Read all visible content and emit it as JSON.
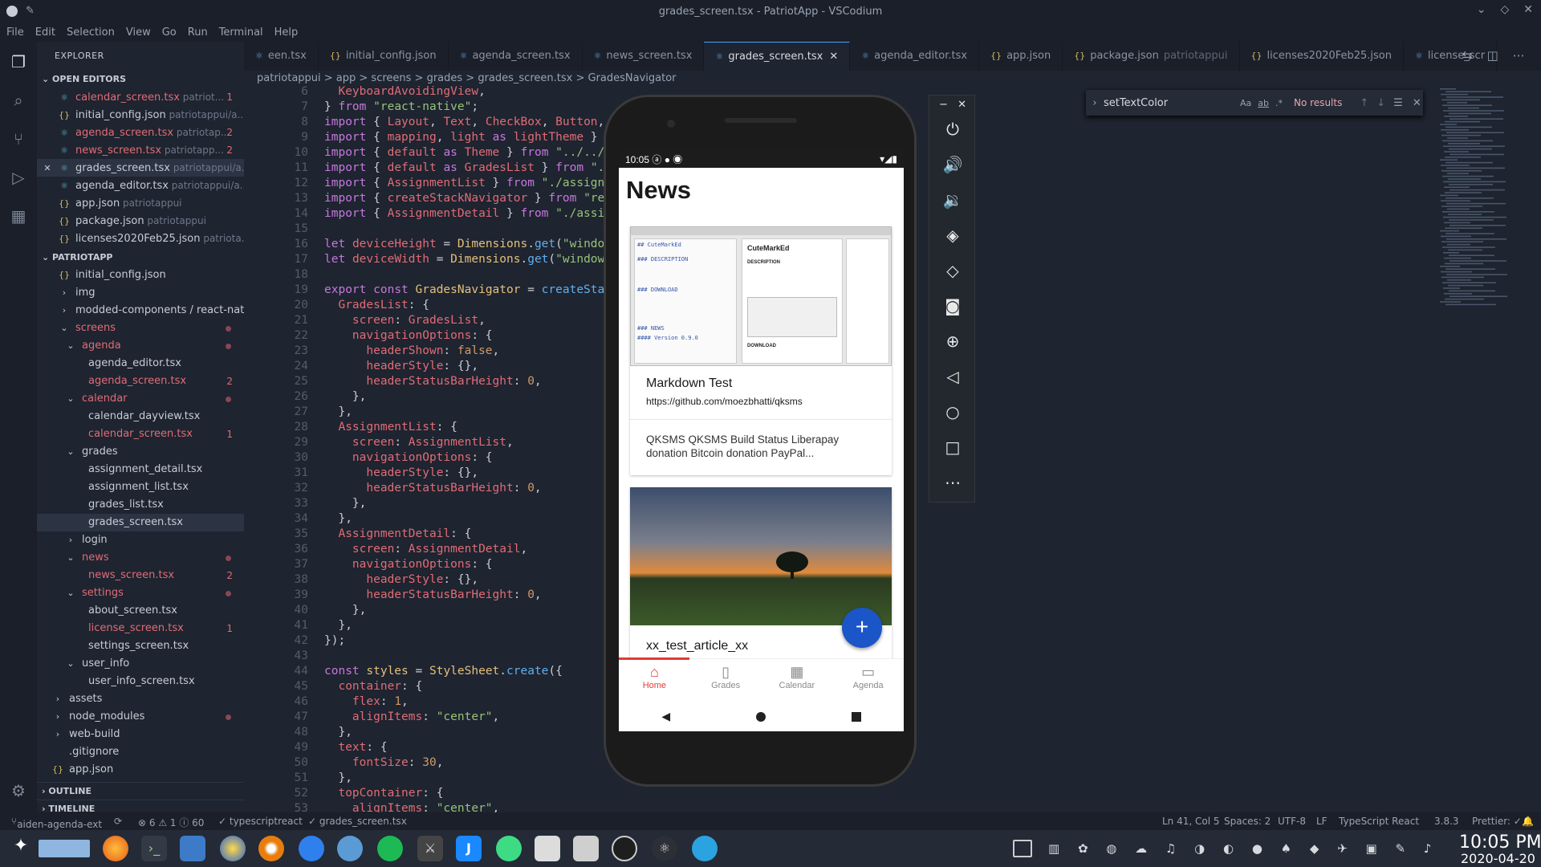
{
  "window": {
    "title": "grades_screen.tsx - PatriotApp - VSCodium"
  },
  "menu": [
    "File",
    "Edit",
    "Selection",
    "View",
    "Go",
    "Run",
    "Terminal",
    "Help"
  ],
  "explorer": {
    "title": "EXPLORER",
    "open_editors_label": "OPEN EDITORS",
    "open_editors": [
      {
        "name": "calendar_screen.tsx",
        "path": "patriot...",
        "badge": "1",
        "type": "tsx",
        "modified": true
      },
      {
        "name": "initial_config.json",
        "path": "patriotappui/a...",
        "badge": "",
        "type": "json"
      },
      {
        "name": "agenda_screen.tsx",
        "path": "patriotap...",
        "badge": "2",
        "type": "tsx",
        "modified": true
      },
      {
        "name": "news_screen.tsx",
        "path": "patriotapp...",
        "badge": "2",
        "type": "tsx",
        "modified": true
      },
      {
        "name": "grades_screen.tsx",
        "path": "patriotappui/a...",
        "badge": "",
        "type": "tsx",
        "active": true
      },
      {
        "name": "agenda_editor.tsx",
        "path": "patriotappui/a...",
        "badge": "",
        "type": "tsx"
      },
      {
        "name": "app.json",
        "path": "patriotappui",
        "badge": "",
        "type": "json"
      },
      {
        "name": "package.json",
        "path": "patriotappui",
        "badge": "",
        "type": "json"
      },
      {
        "name": "licenses2020Feb25.json",
        "path": "patriota...",
        "badge": "",
        "type": "json"
      }
    ],
    "project_label": "PATRIOTAPP",
    "tree": [
      {
        "name": "initial_config.json",
        "indent": 1,
        "kind": "json"
      },
      {
        "name": "img",
        "indent": 1,
        "kind": "folder-closed"
      },
      {
        "name": "modded-components / react-nati...",
        "indent": 1,
        "kind": "folder-closed"
      },
      {
        "name": "screens",
        "indent": 1,
        "kind": "folder-open",
        "red": true,
        "dot": true
      },
      {
        "name": "agenda",
        "indent": 2,
        "kind": "folder-open",
        "red": true,
        "dot": true
      },
      {
        "name": "agenda_editor.tsx",
        "indent": 3,
        "kind": "file"
      },
      {
        "name": "agenda_screen.tsx",
        "indent": 3,
        "kind": "file",
        "red": true,
        "badge": "2"
      },
      {
        "name": "calendar",
        "indent": 2,
        "kind": "folder-open",
        "red": true,
        "dot": true
      },
      {
        "name": "calendar_dayview.tsx",
        "indent": 3,
        "kind": "file"
      },
      {
        "name": "calendar_screen.tsx",
        "indent": 3,
        "kind": "file",
        "red": true,
        "badge": "1"
      },
      {
        "name": "grades",
        "indent": 2,
        "kind": "folder-open"
      },
      {
        "name": "assignment_detail.tsx",
        "indent": 3,
        "kind": "file"
      },
      {
        "name": "assignment_list.tsx",
        "indent": 3,
        "kind": "file"
      },
      {
        "name": "grades_list.tsx",
        "indent": 3,
        "kind": "file"
      },
      {
        "name": "grades_screen.tsx",
        "indent": 3,
        "kind": "file",
        "selected": true
      },
      {
        "name": "login",
        "indent": 2,
        "kind": "folder-closed"
      },
      {
        "name": "news",
        "indent": 2,
        "kind": "folder-open",
        "red": true,
        "dot": true
      },
      {
        "name": "news_screen.tsx",
        "indent": 3,
        "kind": "file",
        "red": true,
        "badge": "2"
      },
      {
        "name": "settings",
        "indent": 2,
        "kind": "folder-open",
        "red": true,
        "dot": true
      },
      {
        "name": "about_screen.tsx",
        "indent": 3,
        "kind": "file"
      },
      {
        "name": "license_screen.tsx",
        "indent": 3,
        "kind": "file",
        "red": true,
        "badge": "1"
      },
      {
        "name": "settings_screen.tsx",
        "indent": 3,
        "kind": "file"
      },
      {
        "name": "user_info",
        "indent": 2,
        "kind": "folder-open"
      },
      {
        "name": "user_info_screen.tsx",
        "indent": 3,
        "kind": "file"
      },
      {
        "name": "assets",
        "indent": 0,
        "kind": "folder-closed"
      },
      {
        "name": "node_modules",
        "indent": 0,
        "kind": "folder-closed",
        "dot": true
      },
      {
        "name": "web-build",
        "indent": 0,
        "kind": "folder-closed"
      },
      {
        "name": ".gitignore",
        "indent": 0,
        "kind": "plain"
      },
      {
        "name": "app.json",
        "indent": 0,
        "kind": "json"
      }
    ],
    "outline_label": "OUTLINE",
    "timeline_label": "TIMELINE"
  },
  "tabs": [
    {
      "label": "een.tsx",
      "type": "tsx"
    },
    {
      "label": "initial_config.json",
      "type": "json"
    },
    {
      "label": "agenda_screen.tsx",
      "type": "tsx"
    },
    {
      "label": "news_screen.tsx",
      "type": "tsx"
    },
    {
      "label": "grades_screen.tsx",
      "type": "tsx",
      "active": true
    },
    {
      "label": "agenda_editor.tsx",
      "type": "tsx"
    },
    {
      "label": "app.json",
      "type": "json"
    },
    {
      "label": "package.json",
      "type": "json",
      "hint": "patriotappui"
    },
    {
      "label": "licenses2020Feb25.json",
      "type": "json"
    },
    {
      "label": "license_scr",
      "type": "tsx"
    }
  ],
  "breadcrumb": "patriotappui > app > screens > grades > grades_screen.tsx > GradesNavigator",
  "editor": {
    "lines": [
      {
        "n": "6",
        "html": "  <span class='p'>KeyboardAvoidingView</span>,"
      },
      {
        "n": "7",
        "html": "} <span class='k'>from</span> <span class='s'>\"react-native\"</span>;"
      },
      {
        "n": "8",
        "html": "<span class='k'>import</span> { <span class='p'>Layout</span>, <span class='p'>Text</span>, <span class='p'>CheckBox</span>, <span class='p'>Button</span>, <span class='p'>Inpu</span>"
      },
      {
        "n": "9",
        "html": "<span class='k'>import</span> { <span class='p'>mapping</span>, <span class='p'>light</span> <span class='k'>as</span> <span class='p'>lightTheme</span> } <span class='k'>from</span>"
      },
      {
        "n": "10",
        "html": "<span class='k'>import</span> { <span class='p'>default</span> <span class='k'>as</span> <span class='p'>Theme</span> } <span class='k'>from</span> <span class='s'>\"../../../cu</span>"
      },
      {
        "n": "11",
        "html": "<span class='k'>import</span> { <span class='p'>default</span> <span class='k'>as</span> <span class='p'>GradesList</span> } <span class='k'>from</span> <span class='s'>\"./grad</span>"
      },
      {
        "n": "12",
        "html": "<span class='k'>import</span> { <span class='p'>AssignmentList</span> } <span class='k'>from</span> <span class='s'>\"./assignment_</span>"
      },
      {
        "n": "13",
        "html": "<span class='k'>import</span> { <span class='p'>createStackNavigator</span> } <span class='k'>from</span> <span class='s'>\"react-r</span>"
      },
      {
        "n": "14",
        "html": "<span class='k'>import</span> { <span class='p'>AssignmentDetail</span> } <span class='k'>from</span> <span class='s'>\"./assignmer</span>"
      },
      {
        "n": "15",
        "html": ""
      },
      {
        "n": "16",
        "html": "<span class='k'>let</span> <span class='p'>deviceHeight</span> = <span class='t'>Dimensions</span>.<span class='f'>get</span>(<span class='s'>\"window\"</span>).h"
      },
      {
        "n": "17",
        "html": "<span class='k'>let</span> <span class='p'>deviceWidth</span> = <span class='t'>Dimensions</span>.<span class='f'>get</span>(<span class='s'>\"window\"</span>).wi"
      },
      {
        "n": "18",
        "html": ""
      },
      {
        "n": "19",
        "html": "<span class='k'>export</span> <span class='k'>const</span> <span class='t'>GradesNavigator</span> = <span class='f'>createStackNav</span>"
      },
      {
        "n": "20",
        "html": "  <span class='p'>GradesList</span>: {"
      },
      {
        "n": "21",
        "html": "    <span class='p'>screen</span>: <span class='p'>GradesList</span>,"
      },
      {
        "n": "22",
        "html": "    <span class='p'>navigationOptions</span>: {"
      },
      {
        "n": "23",
        "html": "      <span class='p'>headerShown</span>: <span class='n'>false</span>,"
      },
      {
        "n": "24",
        "html": "      <span class='p'>headerStyle</span>: {},"
      },
      {
        "n": "25",
        "html": "      <span class='p'>headerStatusBarHeight</span>: <span class='n'>0</span>,"
      },
      {
        "n": "26",
        "html": "    },"
      },
      {
        "n": "27",
        "html": "  },"
      },
      {
        "n": "28",
        "html": "  <span class='p'>AssignmentList</span>: {"
      },
      {
        "n": "29",
        "html": "    <span class='p'>screen</span>: <span class='p'>AssignmentList</span>,"
      },
      {
        "n": "30",
        "html": "    <span class='p'>navigationOptions</span>: {"
      },
      {
        "n": "31",
        "html": "      <span class='p'>headerStyle</span>: {},"
      },
      {
        "n": "32",
        "html": "      <span class='p'>headerStatusBarHeight</span>: <span class='n'>0</span>,"
      },
      {
        "n": "33",
        "html": "    },"
      },
      {
        "n": "34",
        "html": "  },"
      },
      {
        "n": "35",
        "html": "  <span class='p'>AssignmentDetail</span>: {"
      },
      {
        "n": "36",
        "html": "    <span class='p'>screen</span>: <span class='p'>AssignmentDetail</span>,"
      },
      {
        "n": "37",
        "html": "    <span class='p'>navigationOptions</span>: {"
      },
      {
        "n": "38",
        "html": "      <span class='p'>headerStyle</span>: {},"
      },
      {
        "n": "39",
        "html": "      <span class='p'>headerStatusBarHeight</span>: <span class='n'>0</span>,"
      },
      {
        "n": "40",
        "html": "    },"
      },
      {
        "n": "41",
        "html": "  },"
      },
      {
        "n": "42",
        "html": "});"
      },
      {
        "n": "43",
        "html": ""
      },
      {
        "n": "44",
        "html": "<span class='k'>const</span> <span class='t'>styles</span> = <span class='t'>StyleSheet</span>.<span class='f'>create</span>({"
      },
      {
        "n": "45",
        "html": "  <span class='p'>container</span>: {"
      },
      {
        "n": "46",
        "html": "    <span class='p'>flex</span>: <span class='n'>1</span>,"
      },
      {
        "n": "47",
        "html": "    <span class='p'>alignItems</span>: <span class='s'>\"center\"</span>,"
      },
      {
        "n": "48",
        "html": "  },"
      },
      {
        "n": "49",
        "html": "  <span class='p'>text</span>: {"
      },
      {
        "n": "50",
        "html": "    <span class='p'>fontSize</span>: <span class='n'>30</span>,"
      },
      {
        "n": "51",
        "html": "  },"
      },
      {
        "n": "52",
        "html": "  <span class='p'>topContainer</span>: {"
      },
      {
        "n": "53",
        "html": "    <span class='p'>alignItems</span>: <span class='s'>\"center\"</span>,"
      }
    ]
  },
  "find": {
    "query": "setTextColor",
    "result": "No results",
    "case": "Aa",
    "word": "ab",
    "regex": ".*"
  },
  "phone": {
    "time": "10:05",
    "header": "News",
    "card1": {
      "title": "Markdown Test",
      "url": "https://github.com/moezbhatti/qksms",
      "excerpt": "QKSMS  QKSMS  Build Status Liberapay donation Bitcoin donation PayPal..."
    },
    "card2": {
      "title": "xx_test_article_xx"
    },
    "thumb1": {
      "name": "CuteMarkEd",
      "h1": "DESCRIPTION",
      "h2": "DOWNLOAD",
      "h3": "NEWS",
      "h4": "Version 0.9.0"
    },
    "fab": "+",
    "tabs": [
      {
        "label": "Home",
        "active": true
      },
      {
        "label": "Grades"
      },
      {
        "label": "Calendar"
      },
      {
        "label": "Agenda"
      }
    ]
  },
  "status": {
    "branch": "aiden-agenda-ext",
    "problems": "⊗ 6  ⚠ 1  ⓘ 60",
    "lang1": "✓ typescriptreact",
    "file": "✓ grades_screen.tsx",
    "position": "Ln 41, Col 5",
    "spaces": "Spaces: 2",
    "encoding": "UTF-8",
    "eol": "LF",
    "language": "TypeScript React",
    "version": "3.8.3",
    "prettier": "Prettier: ✓"
  },
  "clock": {
    "time": "10:05 PM",
    "date": "2020-04-20"
  },
  "colors": {
    "accent": "#4aa3ff",
    "error": "#e06c75",
    "fab": "#1a56c8",
    "homeTab": "#e53935"
  }
}
